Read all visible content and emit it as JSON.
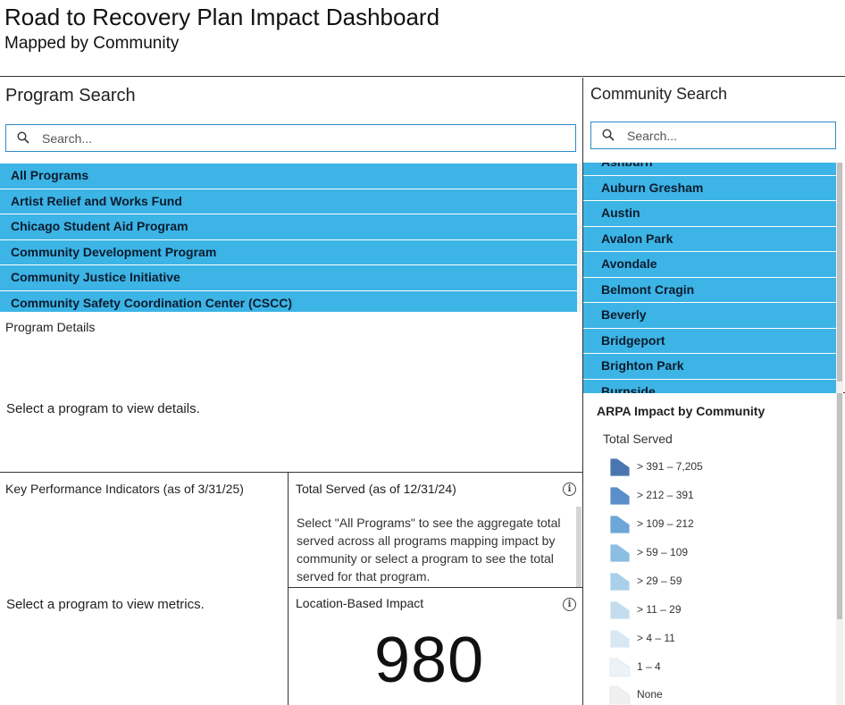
{
  "header": {
    "title": "Road to Recovery Plan Impact Dashboard",
    "subtitle": "Mapped by Community"
  },
  "program_search": {
    "title": "Program Search",
    "placeholder": "Search...",
    "items": [
      "All Programs",
      "Artist Relief and Works Fund",
      "Chicago Student Aid Program",
      "Community Development Program",
      "Community Justice Initiative",
      "Community Safety Coordination Center (CSCC)"
    ]
  },
  "community_search": {
    "title": "Community Search",
    "placeholder": "Search...",
    "items": [
      "Ashburn",
      "Auburn Gresham",
      "Austin",
      "Avalon Park",
      "Avondale",
      "Belmont Cragin",
      "Beverly",
      "Bridgeport",
      "Brighton Park",
      "Burnside"
    ]
  },
  "program_details": {
    "title": "Program Details",
    "placeholder": "Select a program to view details."
  },
  "kpi": {
    "title": "Key Performance Indicators (as of 3/31/25)",
    "placeholder": "Select a program to view metrics."
  },
  "total_served": {
    "title": "Total Served (as of 12/31/24)",
    "description": "Select \"All Programs\" to see the aggregate total served across all programs mapping impact by community or select a program to see the total served for that program."
  },
  "location_impact": {
    "title": "Location-Based Impact",
    "value": "980"
  },
  "legend": {
    "title": "ARPA Impact by Community",
    "subtitle": "Total Served",
    "entries": [
      {
        "label": "> 391 – 7,205",
        "color": "#4a76b0"
      },
      {
        "label": "> 212 – 391",
        "color": "#5a8fc9"
      },
      {
        "label": "> 109 – 212",
        "color": "#6fa6d8"
      },
      {
        "label": "> 59 – 109",
        "color": "#8cbde3"
      },
      {
        "label": "> 29 – 59",
        "color": "#aacfea"
      },
      {
        "label": "> 11 – 29",
        "color": "#c3dcee"
      },
      {
        "label": "> 4 – 11",
        "color": "#d8e8f3"
      },
      {
        "label": "1 – 4",
        "color": "#ebf2f8"
      },
      {
        "label": "None",
        "color": "#f0f0f0"
      }
    ]
  },
  "colors": {
    "list_highlight": "#3cb4e5",
    "search_border": "#2b8dc7"
  }
}
